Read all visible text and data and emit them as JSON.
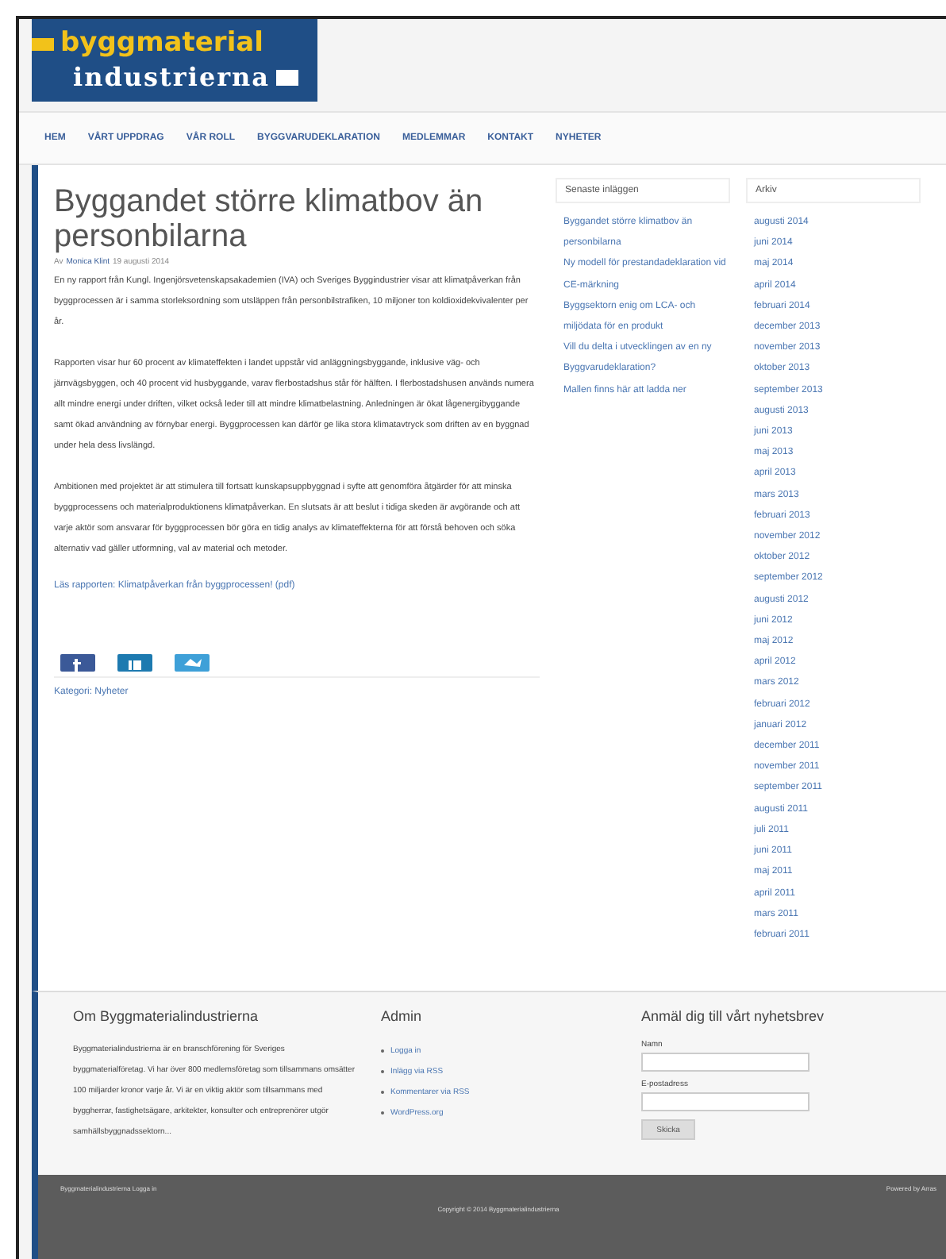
{
  "logo": {
    "line_1": "byggmaterial",
    "line_2": "industrierna"
  },
  "nav": [
    "HEM",
    "VÅRT UPPDRAG",
    "VÅR ROLL",
    "BYGGVARUDEKLARATION",
    "MEDLEMMAR",
    "KONTAKT",
    "NYHETER"
  ],
  "article": {
    "title": "Byggandet större klimatbov än personbilarna",
    "byline_prefix": "Av",
    "author": "Monica Klint",
    "date": "19 augusti 2014",
    "paragraphs": [
      "En ny rapport från Kungl. Ingenjörsvetenskapsakademien (IVA) och Sveriges Byggindustrier visar att klimatpåverkan från byggprocessen är i samma storleksordning som utsläppen från personbilstrafiken, 10 miljoner ton koldioxidekvivalenter per år.",
      "Rapporten visar hur 60 procent av klimateffekten i landet uppstår vid anläggningsbyggande, inklusive väg- och järnvägsbyggen, och 40 procent vid husbyggande, varav flerbostadshus står för hälften. I flerbostadshusen används numera allt mindre energi under driften, vilket också leder till att mindre klimatbelastning. Anledningen är ökat lågenergibyggande samt ökad användning av förnybar energi. Byggprocessen kan därför ge lika stora klimatavtryck som driften av en byggnad under hela dess livslängd.",
      "Ambitionen med projektet är att stimulera till fortsatt kunskapsuppbyggnad i syfte att genomföra åtgärder för att minska byggprocessens och materialproduktionens klimatpåverkan. En slutsats är att beslut i tidiga skeden är avgörande och att varje aktör som ansvarar för byggprocessen bör göra en tidig analys av klimateffekterna för att förstå behoven och söka alternativ vad gäller utformning, val av material och metoder."
    ],
    "link": "Läs rapporten: Klimatpåverkan från byggprocessen! (pdf)",
    "category": "Kategori: Nyheter"
  },
  "recent_posts": {
    "title": "Senaste inläggen",
    "items": [
      "Byggandet större klimatbov än personbilarna",
      "Ny modell för prestandadeklaration vid CE-märkning",
      "Byggsektorn enig om LCA- och miljödata för en produkt",
      "Vill du delta i utvecklingen av en ny Byggvarudeklaration?",
      "Mallen finns här att ladda ner"
    ]
  },
  "archive": {
    "title": "Arkiv",
    "items": [
      "augusti 2014",
      "juni 2014",
      "maj 2014",
      "april 2014",
      "februari 2014",
      "december 2013",
      "november 2013",
      "oktober 2013",
      "september 2013",
      "augusti 2013",
      "juni 2013",
      "maj 2013",
      "april 2013",
      "mars 2013",
      "februari 2013",
      "november 2012",
      "oktober 2012",
      "september 2012",
      "augusti 2012",
      "juni 2012",
      "maj 2012",
      "april 2012",
      "mars 2012",
      "februari 2012",
      "januari 2012",
      "december 2011",
      "november 2011",
      "september 2011",
      "augusti 2011",
      "juli 2011",
      "juni 2011",
      "maj 2011",
      "april 2011",
      "mars 2011",
      "februari 2011"
    ]
  },
  "footer": {
    "about": {
      "title": "Om Byggmaterialindustrierna",
      "text": "Byggmaterialindustrierna är en branschförening för Sveriges byggmaterialföretag. Vi har över 800 medlemsföretag som tillsammans omsätter 100 miljarder kronor varje år. Vi är en viktig aktör som tillsammans med byggherrar, fastighetsägare, arkitekter, konsulter och entreprenörer utgör samhällsbyggnadssektorn..."
    },
    "admin": {
      "title": "Admin",
      "links": [
        "Logga in",
        "Inlägg via RSS",
        "Kommentarer via RSS",
        "WordPress.org"
      ]
    },
    "newsletter": {
      "title": "Anmäl dig till vårt nyhetsbrev",
      "fields": [
        {
          "label": "Namn"
        },
        {
          "label": "E-postadress"
        }
      ],
      "button": "Skicka"
    }
  },
  "bottom_bar": {
    "left": "Byggmaterialindustrierna Logga in",
    "center": "Copyright © 2014 Byggmaterialindustrierna",
    "right": "Powered by Arras"
  }
}
